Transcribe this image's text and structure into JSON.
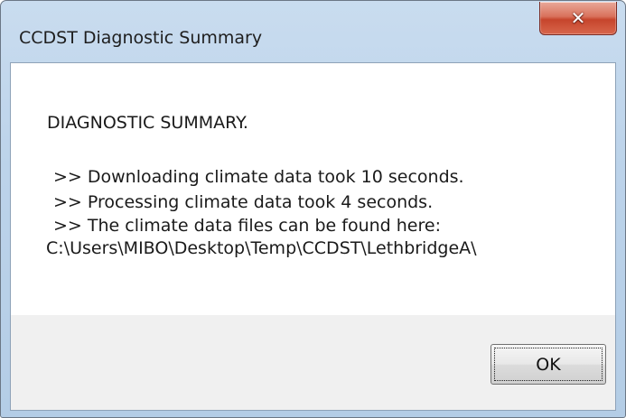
{
  "window": {
    "title": "CCDST Diagnostic Summary",
    "close_icon": "close-icon",
    "close_glyph": "✕"
  },
  "message": {
    "heading": "DIAGNOSTIC SUMMARY.",
    "lines": [
      ">> Downloading climate data took 10 seconds.",
      ">> Processing climate data took 4 seconds.",
      ">> The climate data files can be found here:",
      "C:\\Users\\MIBO\\Desktop\\Temp\\CCDST\\LethbridgeA\\"
    ]
  },
  "buttons": {
    "ok_label": "OK"
  },
  "colors": {
    "close_button": "#c6452c",
    "frame": "#bcd3ea",
    "content_bg": "#ffffff",
    "footer_bg": "#f0f0f0"
  }
}
